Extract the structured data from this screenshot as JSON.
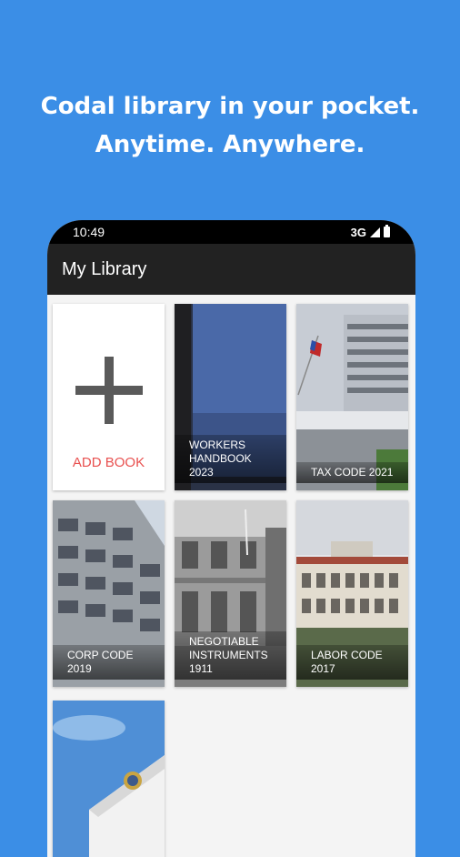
{
  "headline": {
    "line1": "Codal library in your pocket.",
    "line2": "Anytime. Anywhere."
  },
  "status_bar": {
    "time": "10:49",
    "network": "3G",
    "icons": [
      "signal-icon",
      "battery-icon"
    ]
  },
  "app_bar": {
    "title": "My Library"
  },
  "add_book": {
    "label": "ADD BOOK",
    "icon": "plus-icon",
    "color": "#e8504f"
  },
  "books": [
    {
      "title_line1": "WORKERS",
      "title_line2": "HANDBOOK",
      "title_line3": "2023"
    },
    {
      "title_line1": "TAX CODE 2021"
    },
    {
      "title_line1": "CORP CODE",
      "title_line2": "2019"
    },
    {
      "title_line1": "NEGOTIABLE",
      "title_line2": "INSTRUMENTS",
      "title_line3": "1911"
    },
    {
      "title_line1": "LABOR CODE",
      "title_line2": "2017"
    }
  ],
  "colors": {
    "background": "#3b8ee6",
    "app_bar": "#222222",
    "accent": "#e8504f"
  }
}
